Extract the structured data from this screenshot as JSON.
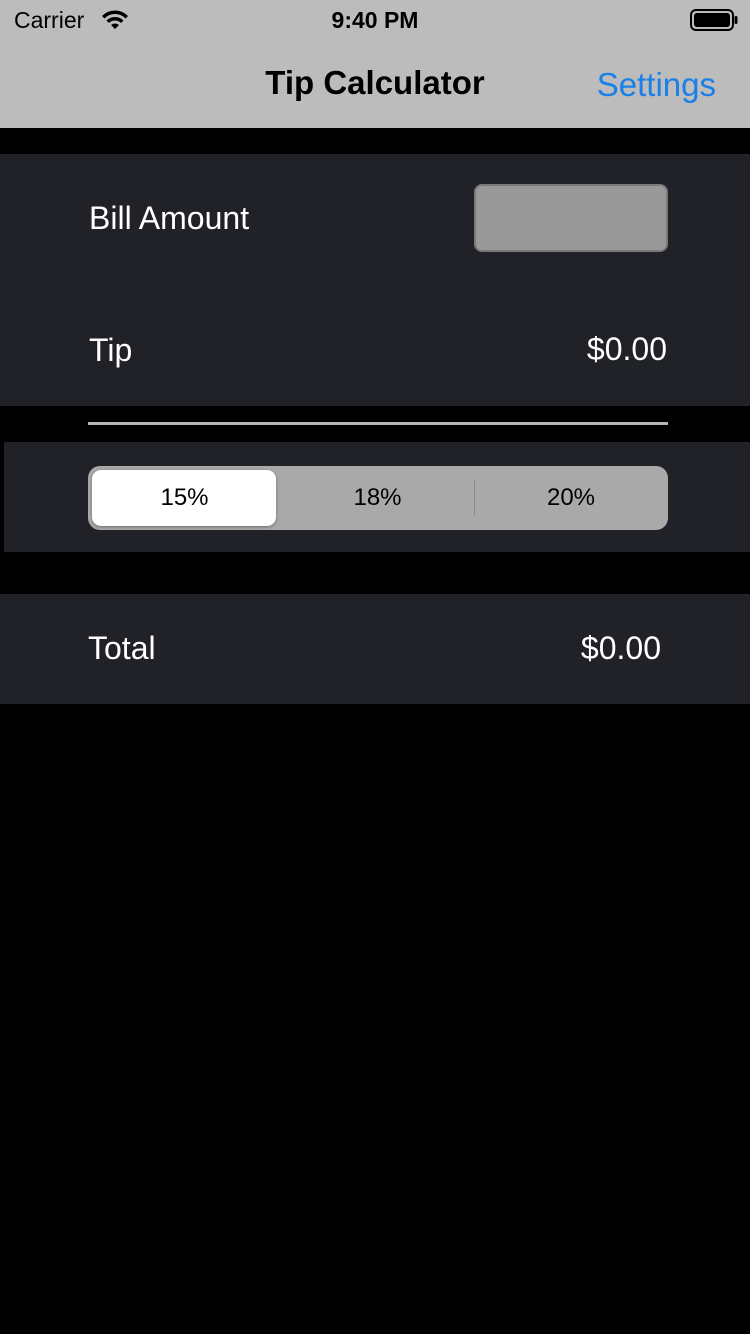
{
  "status_bar": {
    "carrier": "Carrier",
    "time": "9:40 PM",
    "wifi_icon": "wifi-icon",
    "battery_icon": "battery-icon"
  },
  "nav": {
    "title": "Tip Calculator",
    "settings_label": "Settings",
    "accent_color": "#1a7fe8"
  },
  "bill": {
    "label": "Bill Amount",
    "value": "",
    "placeholder": ""
  },
  "tip": {
    "label": "Tip",
    "value": "$0.00"
  },
  "tip_options": {
    "selected": "15%",
    "options": [
      "15%",
      "18%",
      "20%"
    ]
  },
  "total": {
    "label": "Total",
    "value": "$0.00"
  }
}
